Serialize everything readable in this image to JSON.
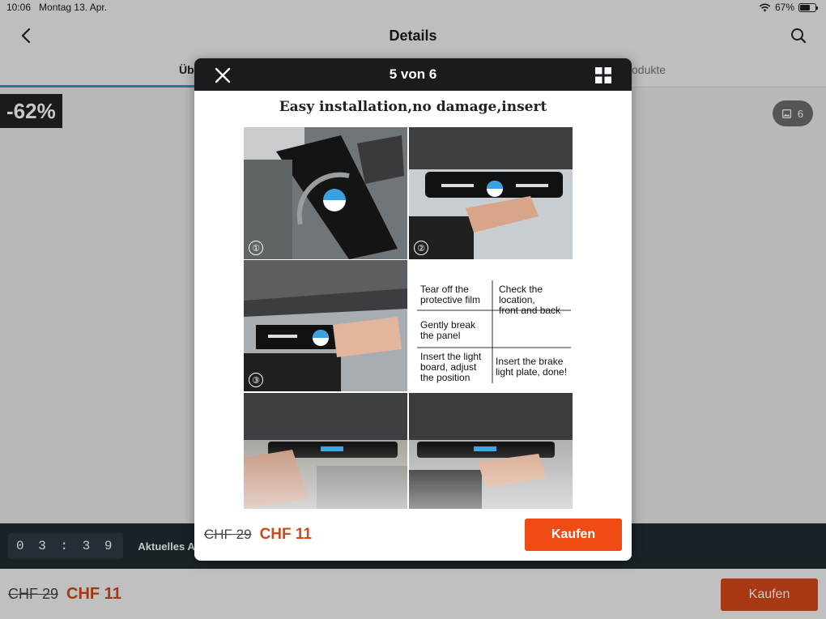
{
  "status_bar": {
    "time": "10:06",
    "date": "Montag 13. Apr.",
    "battery": "67%",
    "battery_level": 0.67
  },
  "nav": {
    "title": "Details"
  },
  "tabs": [
    {
      "label": "Üb"
    },
    {
      "label": "odukte"
    }
  ],
  "badges": {
    "discount": "-62%",
    "image_count": "6"
  },
  "offer": {
    "timer": "03:39",
    "label": "Aktuelles Angebot: Je"
  },
  "pricing": {
    "old_price": "CHF 29",
    "new_price": "CHF 11",
    "buy_label": "Kaufen"
  },
  "modal": {
    "counter": "5 von 6",
    "headline": "Easy installation,no damage,insert",
    "step_numbers": [
      "①",
      "②",
      "③"
    ],
    "instructions": {
      "step1": [
        "Tear off the",
        "protective film"
      ],
      "step2": [
        "Check the location,",
        "front and back"
      ],
      "step3": [
        "Gently break",
        "the panel"
      ],
      "step4": [
        "Insert the light",
        "board,  adjust",
        "the position"
      ],
      "step5": [
        "Insert the brake",
        "light plate,  done!"
      ]
    },
    "old_price": "CHF 29",
    "new_price": "CHF 11",
    "buy_label": "Kaufen"
  },
  "colors": {
    "accent_orange": "#f04a15",
    "tab_accent": "#27a0b8",
    "modal_header": "#1b1b1f",
    "timer_bar": "#1f2c33"
  },
  "icons": [
    "back-chevron-icon",
    "search-icon",
    "close-icon",
    "grid-icon",
    "image-icon",
    "wifi-icon",
    "battery-icon"
  ]
}
